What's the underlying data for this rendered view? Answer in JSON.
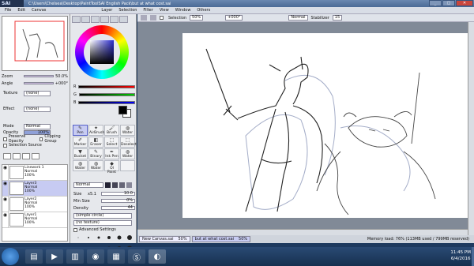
{
  "app": {
    "logo": "SAI",
    "title": "C:\\Users\\Chelsea\\Desktop\\PaintToolSAI English Pack\\but at what cost.sai",
    "window_buttons": [
      "_",
      "▢",
      "✕"
    ]
  },
  "menu": [
    "File",
    "Edit",
    "Canvas",
    "Layer",
    "Selection",
    "Filter",
    "View",
    "Window",
    "Others"
  ],
  "navigator": {
    "zoom_label": "Zoom",
    "zoom_value": "50.0%",
    "angle_label": "Angle",
    "angle_value": "+000°"
  },
  "left": {
    "texture_label": "Texture",
    "texture_value": "(none)",
    "effect_label": "Effect",
    "effect_value": "(none)",
    "mode_label": "Mode",
    "mode_value": "Normal",
    "opacity_label": "Opacity",
    "opacity_value": "100%",
    "preserve_opacity": "Preserve Opacity",
    "clipping_group": "Clipping Group",
    "selection_source": "Selection Source",
    "layers": [
      {
        "name": "Linework 1",
        "mode": "Normal",
        "opacity": "100%"
      },
      {
        "name": "Layer3",
        "mode": "Normal",
        "opacity": "100%"
      },
      {
        "name": "Layer2",
        "mode": "Normal",
        "opacity": "100%"
      },
      {
        "name": "Layer1",
        "mode": "Normal",
        "opacity": "100%"
      }
    ]
  },
  "color": {
    "r_label": "R",
    "g_label": "G",
    "b_label": "B",
    "r_value": "255",
    "g_value": "255",
    "b_value": "255",
    "primary": "#000000",
    "secondary": "#ffffff"
  },
  "tools": [
    {
      "label": "Pen",
      "icon": "✎"
    },
    {
      "label": "AirBrush",
      "icon": "✦"
    },
    {
      "label": "Brush",
      "icon": "🖌"
    },
    {
      "label": "Water",
      "icon": "◍"
    },
    {
      "label": "Marker",
      "icon": "✐"
    },
    {
      "label": "Eraser",
      "icon": "◧"
    },
    {
      "label": "Select",
      "icon": "⬚"
    },
    {
      "label": "Deselect",
      "icon": "⬚"
    },
    {
      "label": "Bucket",
      "icon": "▼"
    },
    {
      "label": "Binary",
      "icon": "✎"
    },
    {
      "label": "Ink Pen",
      "icon": "✒"
    },
    {
      "label": "Water",
      "icon": "◍"
    },
    {
      "label": "Water",
      "icon": "◍"
    },
    {
      "label": "Water",
      "icon": "◍"
    },
    {
      "label": "Ol Paint",
      "icon": "◆"
    },
    {
      "label": "",
      "icon": ""
    }
  ],
  "brush": {
    "mode_value": "Normal",
    "size_label": "Size",
    "size_mult": "x5.1",
    "size_value": "10.0",
    "min_size_label": "Min Size",
    "min_size_value": "0%",
    "density_label": "Density",
    "density_value": "44",
    "shape_value": "(simple circle)",
    "texture_value": "(no texture)",
    "advanced_label": "Advanced Settings"
  },
  "canvas_toolbar": {
    "selection_label": "Selection",
    "zoom": "50%",
    "angle": "+000°",
    "mode": "Normal",
    "stabilizer_label": "Stabilizer",
    "stabilizer_value": "15"
  },
  "docs": [
    {
      "name": "New Canvas.sai",
      "zoom": "50%"
    },
    {
      "name": "but at what cost.sai",
      "zoom": "50%"
    }
  ],
  "memory": "Memory load: 76% (113MB used / 799MB reserved)",
  "taskbar": {
    "time": "11:45 PM",
    "date": "6/4/2016"
  }
}
